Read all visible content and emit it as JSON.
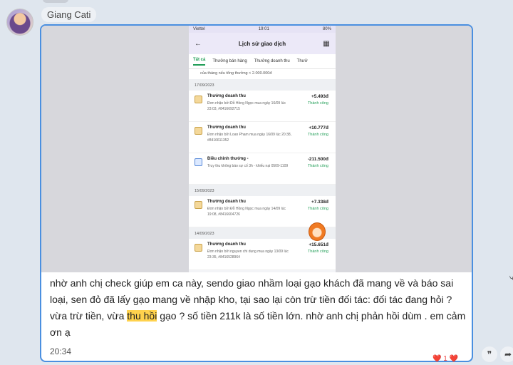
{
  "sender": {
    "name": "Giang Cati"
  },
  "phone": {
    "status_carrier": "Viettel",
    "status_time": "19:01",
    "status_battery": "80%",
    "title": "Lịch sử giao dịch",
    "tabs": [
      "Tất cả",
      "Thưởng bán hàng",
      "Thưởng doanh thu",
      "Thưở"
    ],
    "note": "của tháng nếu tổng thưởng < 2.000.000đ",
    "groups": [
      {
        "date": "17/09/2023",
        "items": [
          {
            "title": "Thưởng doanh thu",
            "desc": "Đơn nhận bởi Đỗ Hồng Ngọc mua ngày 16/09 lúc 23:03, #8416692715",
            "amount": "+5.493đ",
            "status": "Thành công",
            "icon": "reward-icon"
          },
          {
            "title": "Thưởng doanh thu",
            "desc": "Đơn nhận bởi Loan Pham mua ngày 16/09 lúc 20:38, #8416611352",
            "amount": "+10.777đ",
            "status": "Thành công",
            "icon": "reward-icon"
          },
          {
            "title": "Điều chỉnh thưởng -",
            "desc": "Truy thu không báo sự cố 3h - khiếu nại 0509-1109",
            "amount": "-211.500đ",
            "status": "Thành công",
            "icon": "adjust-icon"
          }
        ]
      },
      {
        "date": "15/09/2023",
        "items": [
          {
            "title": "Thưởng doanh thu",
            "desc": "Đơn nhận bởi Đỗ Hồng Ngọc mua ngày 14/09 lúc 19:08, #8416604726",
            "amount": "+7.338đ",
            "status": "Thành công",
            "icon": "reward-icon"
          }
        ]
      },
      {
        "date": "14/09/2023",
        "items": [
          {
            "title": "Thưởng doanh thu",
            "desc": "Đơn nhận bởi nguyen chi dung mua ngày 13/09 lúc 23:35, #8416528964",
            "amount": "+15.651đ",
            "status": "Thành công",
            "icon": "reward-icon"
          }
        ]
      }
    ]
  },
  "message": {
    "text_before": "nhờ anh chị check giúp em ca này, sendo giao nhầm loại gạo khách đã mang về và báo sai loại, sen đỏ đã lấy gạo mang về nhập kho, tại sao lại còn trừ tiền đối tác: đối tác đang hỏi ? vừa trừ tiền, vừa ",
    "highlight": "thu hồi",
    "text_after": " gạo ? số tiền 211k là số tiền lớn. nhờ anh chị phản hồi dùm . em cảm ơn ạ",
    "time": "20:34",
    "reactions": "❤️ 1 ❤️"
  },
  "colors": {
    "accent": "#4a8fe0",
    "success": "#1f9d55",
    "highlight": "#ffd24d"
  }
}
